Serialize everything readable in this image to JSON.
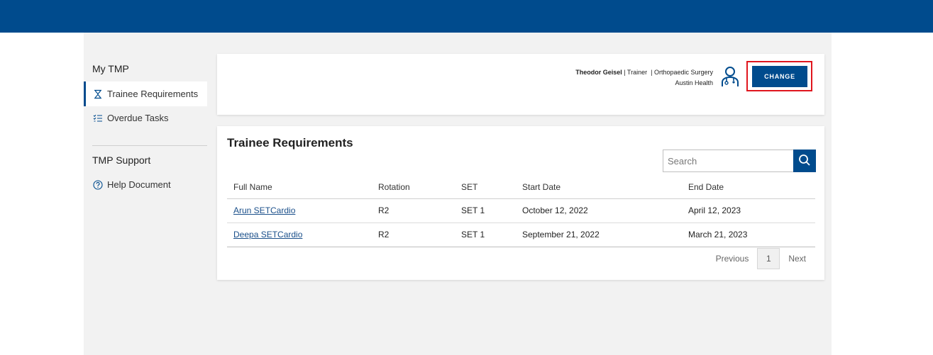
{
  "sidebar": {
    "section1_title": "My TMP",
    "items": [
      {
        "label": "Trainee Requirements",
        "icon": "trainee-requirements-icon",
        "active": true
      },
      {
        "label": "Overdue Tasks",
        "icon": "checklist-icon",
        "active": false
      }
    ],
    "section2_title": "TMP Support",
    "support_items": [
      {
        "label": "Help Document",
        "icon": "question-circle-icon"
      }
    ]
  },
  "header": {
    "user_name": "Theodor Geisel",
    "user_role": "| Trainer",
    "user_specialty": "| Orthopaedic Surgery",
    "user_org": "Austin Health",
    "change_label": "CHANGE"
  },
  "requirements": {
    "title": "Trainee Requirements",
    "search_placeholder": "Search",
    "search_value": "",
    "columns": [
      "Full Name",
      "Rotation",
      "SET",
      "Start Date",
      "End Date"
    ],
    "rows": [
      {
        "name": "Arun SETCardio",
        "rotation": "R2",
        "set": "SET 1",
        "start": "October 12, 2022",
        "end": "April 12, 2023"
      },
      {
        "name": "Deepa SETCardio",
        "rotation": "R2",
        "set": "SET 1",
        "start": "September 21, 2022",
        "end": "March 21, 2023"
      }
    ],
    "pagination": {
      "previous": "Previous",
      "current_page": "1",
      "next": "Next"
    }
  },
  "colors": {
    "brand": "#004b8d",
    "highlight": "#e0161e",
    "background": "#f2f2f2"
  }
}
